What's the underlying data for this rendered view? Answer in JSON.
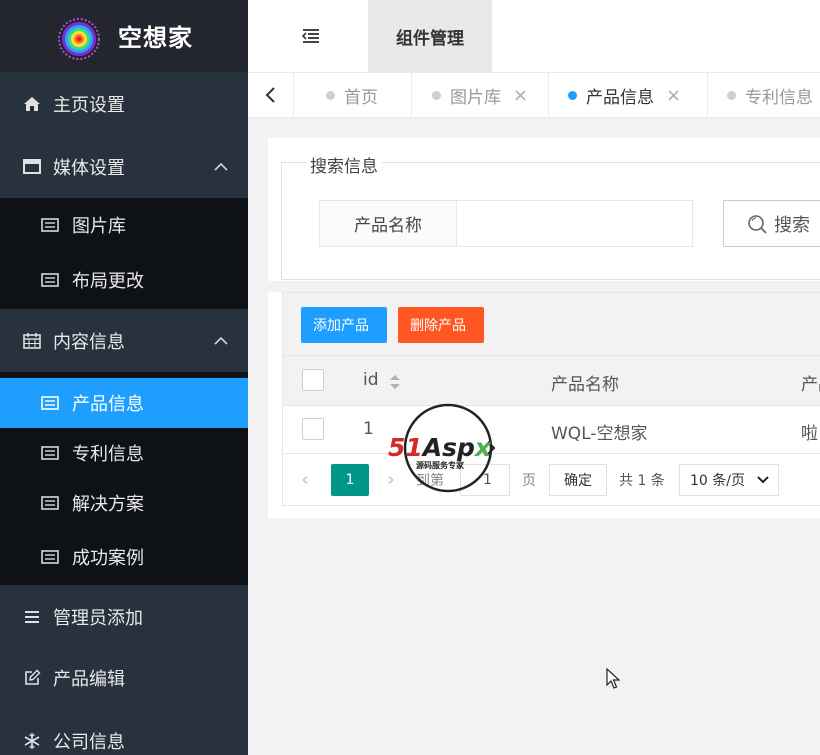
{
  "brand": {
    "name": "空想家"
  },
  "sidebar": {
    "items": [
      {
        "label": "主页设置",
        "icon": "home-icon"
      },
      {
        "label": "媒体设置",
        "icon": "window-icon",
        "expanded": true
      },
      {
        "label": "图片库",
        "icon": "list-icon"
      },
      {
        "label": "布局更改",
        "icon": "list-icon"
      },
      {
        "label": "内容信息",
        "icon": "calendar-icon",
        "expanded": true
      },
      {
        "label": "产品信息",
        "icon": "list-icon",
        "active": true
      },
      {
        "label": "专利信息",
        "icon": "list-icon"
      },
      {
        "label": "解决方案",
        "icon": "list-icon"
      },
      {
        "label": "成功案例",
        "icon": "list-icon"
      },
      {
        "label": "管理员添加",
        "icon": "menu-icon"
      },
      {
        "label": "产品编辑",
        "icon": "edit-icon"
      },
      {
        "label": "公司信息",
        "icon": "snowflake-icon"
      }
    ]
  },
  "header": {
    "active_tab": "组件管理"
  },
  "tabs": [
    {
      "label": "首页"
    },
    {
      "label": "图片库",
      "close": "×"
    },
    {
      "label": "产品信息",
      "close": "×",
      "active": true
    },
    {
      "label": "专利信息"
    }
  ],
  "search": {
    "legend": "搜索信息",
    "field_label": "产品名称",
    "input_value": "",
    "button_label": "搜索"
  },
  "toolbar": {
    "add_label": "添加产品",
    "delete_label": "删除产品"
  },
  "table": {
    "columns": [
      "id",
      "产品名称",
      "产品"
    ],
    "rows": [
      {
        "id": "1",
        "name": "WQL-空想家",
        "extra": "啦"
      }
    ]
  },
  "pager": {
    "current": "1",
    "goto_label": "到第",
    "goto_value": "1",
    "page_unit": "页",
    "confirm_label": "确定",
    "total_label": "共 1 条",
    "page_size": "10 条/页"
  },
  "watermark": {
    "brand": "51Aspx",
    "tagline": "源码服务专家"
  },
  "colors": {
    "accent": "#1e9fff",
    "danger": "#ff5722",
    "pager": "#009688",
    "sidebar": "#28323e"
  }
}
